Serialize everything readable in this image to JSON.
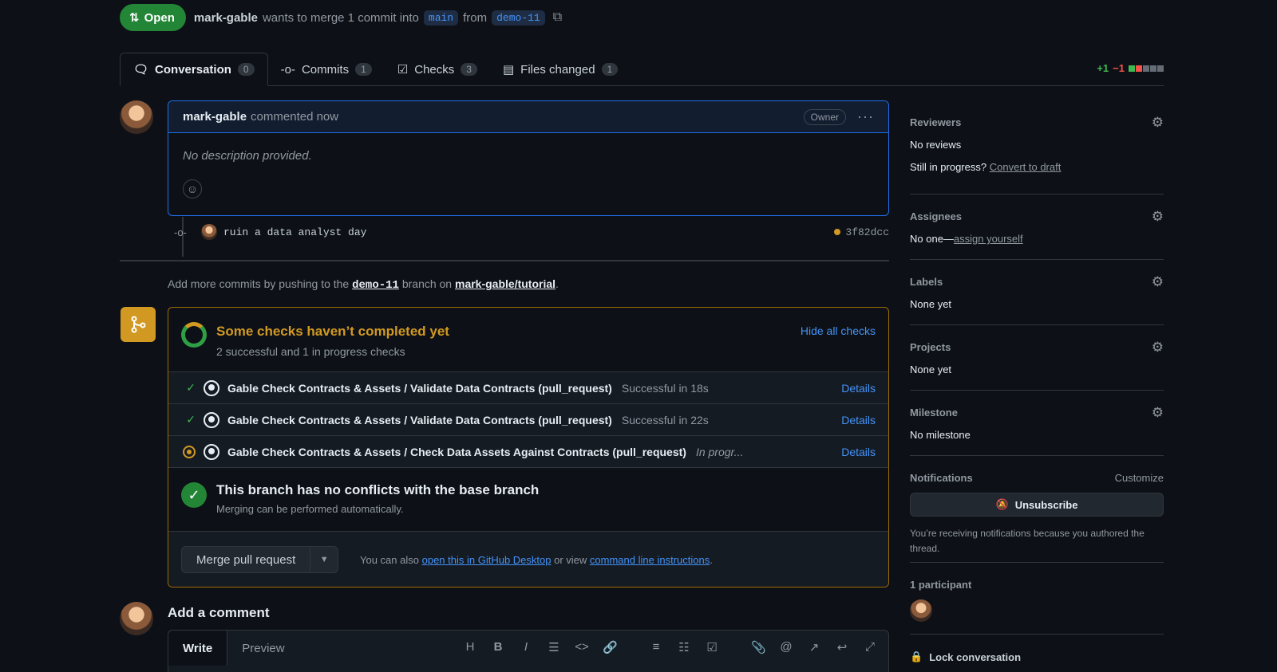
{
  "header": {
    "state": "Open",
    "author": "mark-gable",
    "text_merge": "wants to merge 1 commit into",
    "base_branch": "main",
    "text_from": "from",
    "head_branch": "demo-11"
  },
  "tabs": [
    {
      "label": "Conversation",
      "count": "0"
    },
    {
      "label": "Commits",
      "count": "1"
    },
    {
      "label": "Checks",
      "count": "3"
    },
    {
      "label": "Files changed",
      "count": "1"
    }
  ],
  "diffstat": {
    "additions": "+1",
    "deletions": "−1"
  },
  "comment": {
    "author": "mark-gable",
    "time": "commented now",
    "badge": "Owner",
    "body": "No description provided."
  },
  "commit": {
    "message": "ruin a data analyst day",
    "sha": "3f82dcc"
  },
  "push_note": {
    "prefix": "Add more commits by pushing to the",
    "branch": "demo-11",
    "middle": "branch on",
    "repo": "mark-gable/tutorial",
    "suffix": "."
  },
  "checks": {
    "title": "Some checks haven’t completed yet",
    "subtitle": "2 successful and 1 in progress checks",
    "hide_label": "Hide all checks",
    "details_label": "Details",
    "rows": [
      {
        "name": "Gable Check Contracts & Assets / Validate Data Contracts (pull_request)",
        "result": "Successful in 18s",
        "status": "success"
      },
      {
        "name": "Gable Check Contracts & Assets / Validate Data Contracts (pull_request)",
        "result": "Successful in 22s",
        "status": "success"
      },
      {
        "name": "Gable Check Contracts & Assets / Check Data Assets Against Contracts (pull_request)",
        "result": "In progr...",
        "status": "pending"
      }
    ]
  },
  "conflicts": {
    "title": "This branch has no conflicts with the base branch",
    "subtitle": "Merging can be performed automatically."
  },
  "merge": {
    "button": "Merge pull request",
    "hint_prefix": "You can also",
    "desktop_link": "open this in GitHub Desktop",
    "hint_middle": "or view",
    "cli_link": "command line instructions",
    "hint_suffix": "."
  },
  "add_comment": {
    "title": "Add a comment",
    "tab_write": "Write",
    "tab_preview": "Preview"
  },
  "sidebar": {
    "reviewers": {
      "title": "Reviewers",
      "value": "No reviews",
      "draft_prefix": "Still in progress?",
      "draft_link": "Convert to draft"
    },
    "assignees": {
      "title": "Assignees",
      "prefix": "No one—",
      "link": "assign yourself"
    },
    "labels": {
      "title": "Labels",
      "value": "None yet"
    },
    "projects": {
      "title": "Projects",
      "value": "None yet"
    },
    "milestone": {
      "title": "Milestone",
      "value": "No milestone"
    },
    "notifications": {
      "title": "Notifications",
      "customize": "Customize",
      "button": "Unsubscribe",
      "note": "You’re receiving notifications because you authored the thread."
    },
    "participants": {
      "title": "1 participant"
    },
    "lock": "Lock conversation"
  },
  "colors": {
    "open": "#238636",
    "pending": "#d29922",
    "success": "#3fb950",
    "link": "#4493f8"
  }
}
